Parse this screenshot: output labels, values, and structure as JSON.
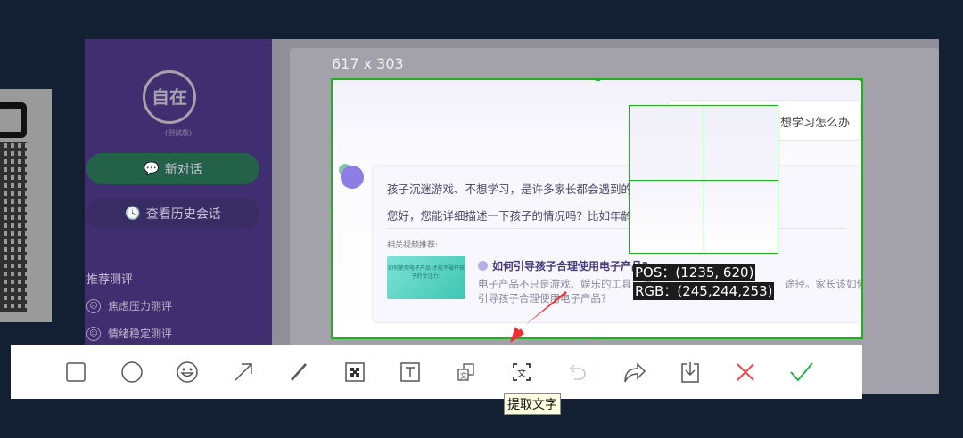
{
  "selection": {
    "size_label": "617 x 303"
  },
  "sidebar": {
    "logo_text": "自在",
    "beta_label": "(测试版)",
    "new_chat": "新对话",
    "history": "查看历史会话",
    "recommend_title": "推荐测评",
    "recommend_items": [
      "焦虑压力测评",
      "情绪稳定测评"
    ]
  },
  "chat": {
    "user_question": "想学习怎么办",
    "bot_line1": "孩子沉迷游戏、不想学习，是许多家长都会遇到的问",
    "bot_line2": "您好，您能详细描述一下孩子的情况吗？比如年龄、",
    "related_title": "相关视频推荐:",
    "thumb_text": "如何使用电子产品 才能不破坏孩子的专注力?",
    "video_title": "如何引导孩子合理使用电子产品?",
    "video_desc1": "电子产品不只是游戏、娱乐的工具，也",
    "video_desc1b": "途径。家长该如何",
    "video_desc2": "引导孩子合理使用电子产品?"
  },
  "magnifier": {
    "pos_label": "POS：(1235, 620)",
    "rgb_label": "RGB：(245,244,253)"
  },
  "toolbar": {
    "tooltip": "提取文字",
    "tools": [
      "rectangle",
      "ellipse",
      "emoji",
      "arrow",
      "pen",
      "mosaic",
      "text",
      "translate",
      "extract-text",
      "undo",
      "share",
      "save",
      "cancel",
      "confirm"
    ]
  },
  "colors": {
    "selection": "#22b022",
    "cancel": "#f04848",
    "confirm": "#22b04a",
    "sidebar": "#402f70"
  }
}
